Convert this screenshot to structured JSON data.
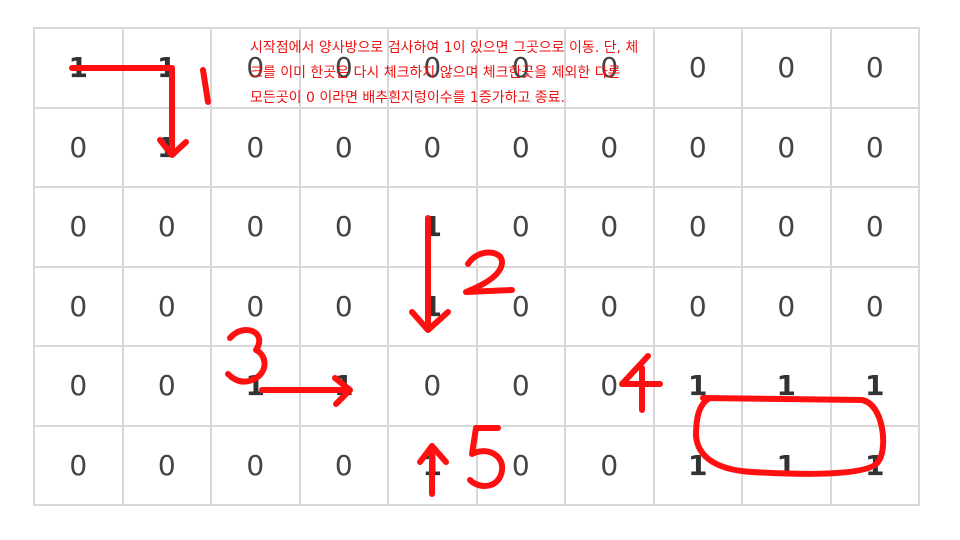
{
  "grid": {
    "rows": [
      [
        "1",
        "1",
        "0",
        "0",
        "0",
        "0",
        "0",
        "0",
        "0",
        "0"
      ],
      [
        "0",
        "1",
        "0",
        "0",
        "0",
        "0",
        "0",
        "0",
        "0",
        "0"
      ],
      [
        "0",
        "0",
        "0",
        "0",
        "1",
        "0",
        "0",
        "0",
        "0",
        "0"
      ],
      [
        "0",
        "0",
        "0",
        "0",
        "1",
        "0",
        "0",
        "0",
        "0",
        "0"
      ],
      [
        "0",
        "0",
        "1",
        "1",
        "0",
        "0",
        "0",
        "1",
        "1",
        "1"
      ],
      [
        "0",
        "0",
        "0",
        "0",
        "1",
        "0",
        "0",
        "1",
        "1",
        "1"
      ]
    ]
  },
  "note": {
    "lines": [
      "시작점에서 양사방으로 검사하여 1이 있으면 그곳으로 이동. 단, 체",
      "크를 이미 한곳은 다시 체크하지 않으며 체크한곳을 제외한 다른",
      "모든곳이 0 이라면 배추흰지렁이수를 1증가하고 종료."
    ]
  },
  "annotations": {
    "color": "#ff1010",
    "step_labels": [
      "1",
      "2",
      "3",
      "4",
      "5"
    ]
  }
}
